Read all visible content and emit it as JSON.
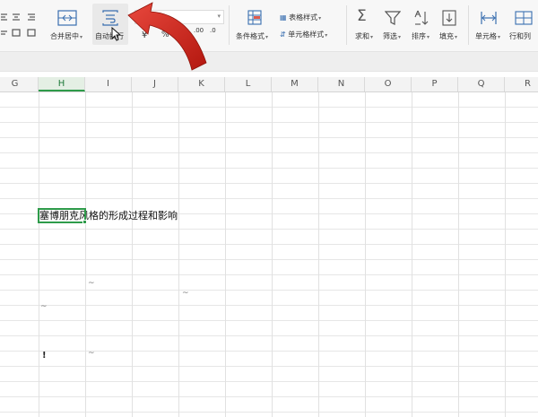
{
  "ribbon": {
    "merge_center": "合并居中",
    "wrap_text": "自动换行",
    "percent_symbol": "%",
    "increase_decimal": ".00",
    "decrease_decimal": ".0",
    "thousands_symbol": "000",
    "conditional_format": "条件格式",
    "table_style": "表格样式",
    "cell_style": "单元格样式",
    "sum": "求和",
    "filter": "筛选",
    "sort": "排序",
    "fill": "填充",
    "cell": "单元格",
    "row_column": "行和列"
  },
  "sheet": {
    "columns": [
      "G",
      "H",
      "I",
      "J",
      "K",
      "L",
      "M",
      "N",
      "O",
      "P",
      "Q",
      "R"
    ],
    "active_column": "H",
    "cell_text": "塞博朋克风格的形成过程和影响"
  },
  "colors": {
    "selection": "#2e9b4a",
    "arrow": "#d42a22",
    "icon_blue": "#3a6fb0"
  }
}
